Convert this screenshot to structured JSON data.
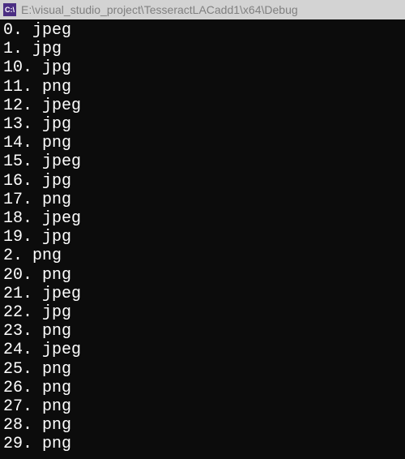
{
  "titlebar": {
    "icon_label": "C:\\",
    "path": "E:\\visual_studio_project\\TesseractLACadd1\\x64\\Debug"
  },
  "console": {
    "lines": [
      "0. jpeg",
      "1. jpg",
      "10. jpg",
      "11. png",
      "12. jpeg",
      "13. jpg",
      "14. png",
      "15. jpeg",
      "16. jpg",
      "17. png",
      "18. jpeg",
      "19. jpg",
      "2. png",
      "20. png",
      "21. jpeg",
      "22. jpg",
      "23. png",
      "24. jpeg",
      "25. png",
      "26. png",
      "27. png",
      "28. png",
      "29. png"
    ]
  }
}
